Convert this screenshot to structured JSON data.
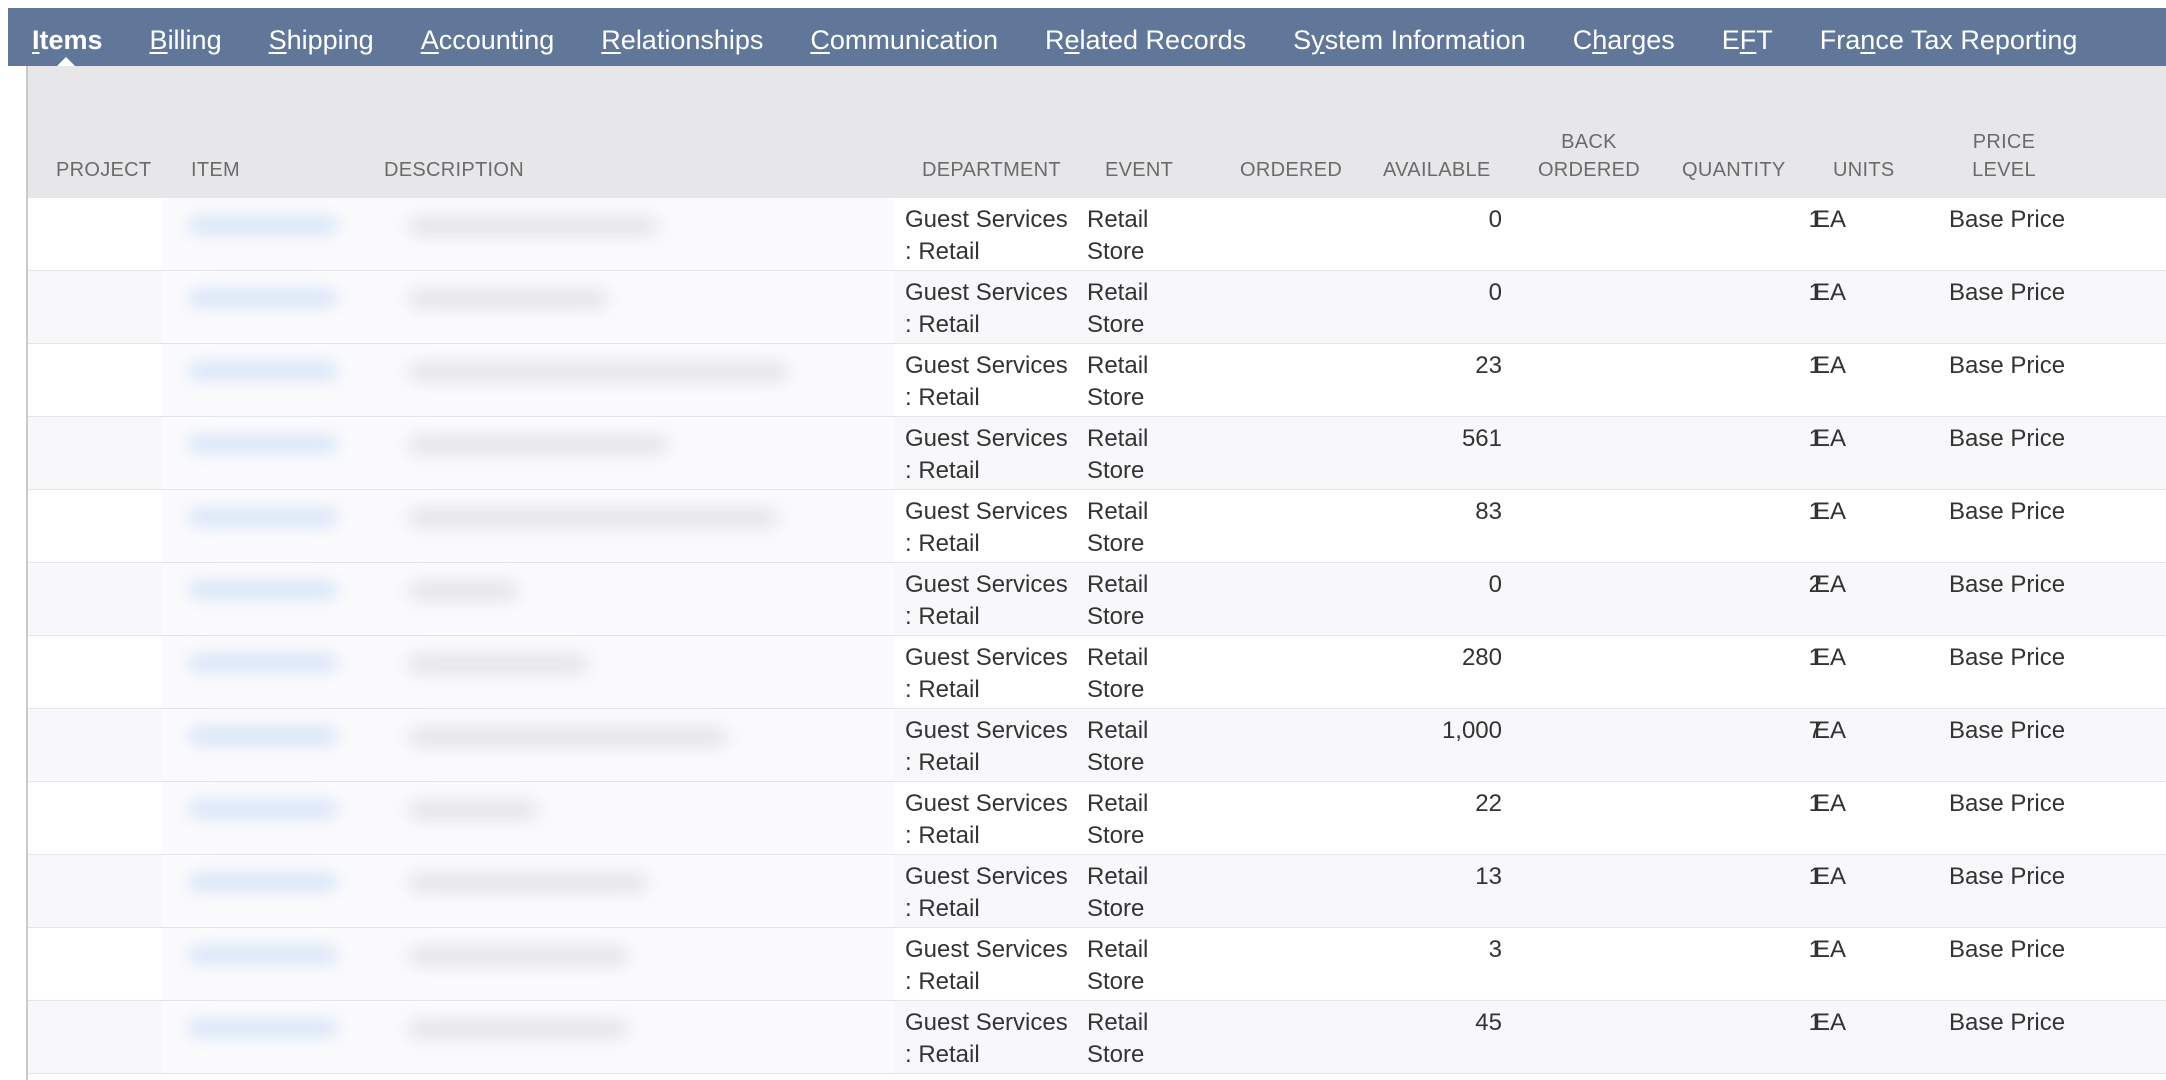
{
  "tabs": [
    {
      "name": "items",
      "pre": "",
      "u": "I",
      "post": "tems",
      "active": true
    },
    {
      "name": "billing",
      "pre": "",
      "u": "B",
      "post": "illing",
      "active": false
    },
    {
      "name": "shipping",
      "pre": "",
      "u": "S",
      "post": "hipping",
      "active": false
    },
    {
      "name": "accounting",
      "pre": "",
      "u": "A",
      "post": "ccounting",
      "active": false
    },
    {
      "name": "relationships",
      "pre": "",
      "u": "R",
      "post": "elationships",
      "active": false
    },
    {
      "name": "communication",
      "pre": "",
      "u": "C",
      "post": "ommunication",
      "active": false
    },
    {
      "name": "related-records",
      "pre": "R",
      "u": "e",
      "post": "lated Records",
      "active": false
    },
    {
      "name": "system-information",
      "pre": "S",
      "u": "y",
      "post": "stem Information",
      "active": false
    },
    {
      "name": "charges",
      "pre": "C",
      "u": "h",
      "post": "arges",
      "active": false
    },
    {
      "name": "eft",
      "pre": "E",
      "u": "F",
      "post": "T",
      "active": false
    },
    {
      "name": "france-tax-reporting",
      "pre": "Fra",
      "u": "n",
      "post": "ce Tax Reporting",
      "active": false
    }
  ],
  "columns": {
    "project": "PROJECT",
    "item": "ITEM",
    "description": "DESCRIPTION",
    "department": "DEPARTMENT",
    "event": "EVENT",
    "ordered": "ORDERED",
    "available": "AVAILABLE",
    "back_ordered_1": "BACK",
    "back_ordered_2": "ORDERED",
    "quantity": "QUANTITY",
    "units": "UNITS",
    "price_level_1": "PRICE",
    "price_level_2": "LEVEL"
  },
  "rows": [
    {
      "department_1": "Guest Services",
      "department_2": ": Retail",
      "event_1": "Retail",
      "event_2": "Store",
      "available": "0",
      "quantity": "1",
      "units": "EA",
      "price_level": "Base Price"
    },
    {
      "department_1": "Guest Services",
      "department_2": ": Retail",
      "event_1": "Retail",
      "event_2": "Store",
      "available": "0",
      "quantity": "1",
      "units": "EA",
      "price_level": "Base Price"
    },
    {
      "department_1": "Guest Services",
      "department_2": ": Retail",
      "event_1": "Retail",
      "event_2": "Store",
      "available": "23",
      "quantity": "1",
      "units": "EA",
      "price_level": "Base Price"
    },
    {
      "department_1": "Guest Services",
      "department_2": ": Retail",
      "event_1": "Retail",
      "event_2": "Store",
      "available": "561",
      "quantity": "1",
      "units": "EA",
      "price_level": "Base Price"
    },
    {
      "department_1": "Guest Services",
      "department_2": ": Retail",
      "event_1": "Retail",
      "event_2": "Store",
      "available": "83",
      "quantity": "1",
      "units": "EA",
      "price_level": "Base Price"
    },
    {
      "department_1": "Guest Services",
      "department_2": ": Retail",
      "event_1": "Retail",
      "event_2": "Store",
      "available": "0",
      "quantity": "2",
      "units": "EA",
      "price_level": "Base Price"
    },
    {
      "department_1": "Guest Services",
      "department_2": ": Retail",
      "event_1": "Retail",
      "event_2": "Store",
      "available": "280",
      "quantity": "1",
      "units": "EA",
      "price_level": "Base Price"
    },
    {
      "department_1": "Guest Services",
      "department_2": ": Retail",
      "event_1": "Retail",
      "event_2": "Store",
      "available": "1,000",
      "quantity": "7",
      "units": "EA",
      "price_level": "Base Price"
    },
    {
      "department_1": "Guest Services",
      "department_2": ": Retail",
      "event_1": "Retail",
      "event_2": "Store",
      "available": "22",
      "quantity": "1",
      "units": "EA",
      "price_level": "Base Price"
    },
    {
      "department_1": "Guest Services",
      "department_2": ": Retail",
      "event_1": "Retail",
      "event_2": "Store",
      "available": "13",
      "quantity": "1",
      "units": "EA",
      "price_level": "Base Price"
    },
    {
      "department_1": "Guest Services",
      "department_2": ": Retail",
      "event_1": "Retail",
      "event_2": "Store",
      "available": "3",
      "quantity": "1",
      "units": "EA",
      "price_level": "Base Price"
    },
    {
      "department_1": "Guest Services",
      "department_2": ": Retail",
      "event_1": "Retail",
      "event_2": "Store",
      "available": "45",
      "quantity": "1",
      "units": "EA",
      "price_level": "Base Price"
    }
  ],
  "colors": {
    "tab_bar": "#607799",
    "header_bg": "#e7e7ea",
    "row_alt": "#f8f8fb"
  }
}
